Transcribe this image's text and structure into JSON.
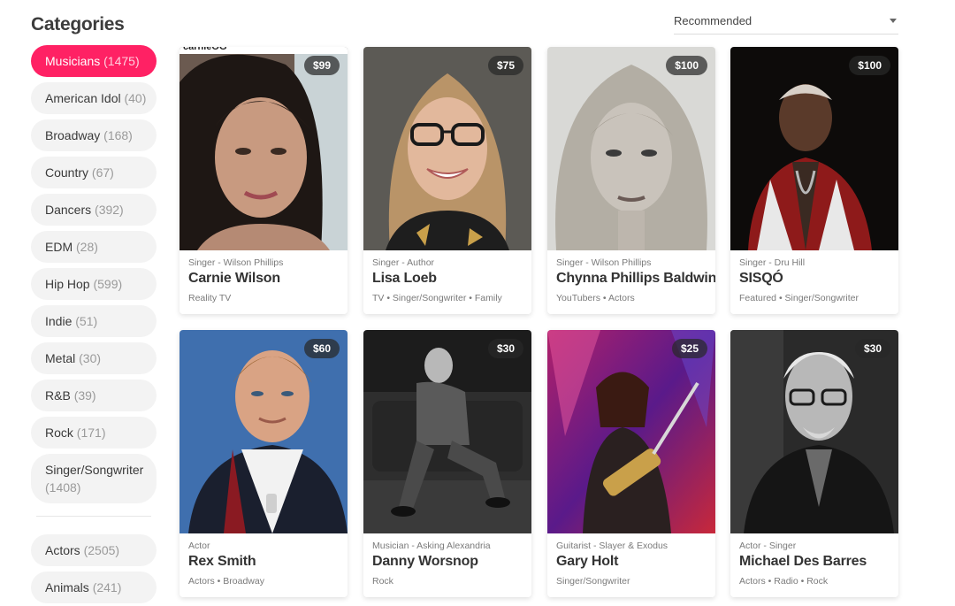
{
  "sidebar": {
    "title": "Categories",
    "categories": [
      {
        "name": "Musicians",
        "count": "(1475)"
      },
      {
        "name": "American Idol",
        "count": "(40)"
      },
      {
        "name": "Broadway",
        "count": "(168)"
      },
      {
        "name": "Country",
        "count": "(67)"
      },
      {
        "name": "Dancers",
        "count": "(392)"
      },
      {
        "name": "EDM",
        "count": "(28)"
      },
      {
        "name": "Hip Hop",
        "count": "(599)"
      },
      {
        "name": "Indie",
        "count": "(51)"
      },
      {
        "name": "Metal",
        "count": "(30)"
      },
      {
        "name": "R&B",
        "count": "(39)"
      },
      {
        "name": "Rock",
        "count": "(171)"
      },
      {
        "name": "Singer/Songwriter",
        "count": "(1408)"
      }
    ],
    "more_categories": [
      {
        "name": "Actors",
        "count": "(2505)"
      },
      {
        "name": "Animals",
        "count": "(241)"
      }
    ]
  },
  "sort": {
    "selected": "Recommended"
  },
  "colors": {
    "accent": "#ff2164"
  },
  "cards": [
    {
      "price": "$99",
      "role": "Singer - Wilson Phillips",
      "name": "Carnie Wilson",
      "tags": "Reality TV",
      "watermark": "carnieOG"
    },
    {
      "price": "$75",
      "role": "Singer - Author",
      "name": "Lisa Loeb",
      "tags": "TV • Singer/Songwriter • Family"
    },
    {
      "price": "$100",
      "role": "Singer - Wilson Phillips",
      "name": "Chynna Phillips Baldwin",
      "tags": "YouTubers • Actors"
    },
    {
      "price": "$100",
      "role": "Singer - Dru Hill",
      "name": "SISQÓ",
      "tags": "Featured • Singer/Songwriter"
    },
    {
      "price": "$60",
      "role": "Actor",
      "name": "Rex Smith",
      "tags": "Actors • Broadway"
    },
    {
      "price": "$30",
      "role": "Musician - Asking Alexandria",
      "name": "Danny Worsnop",
      "tags": "Rock"
    },
    {
      "price": "$25",
      "role": "Guitarist - Slayer & Exodus",
      "name": "Gary Holt",
      "tags": "Singer/Songwriter"
    },
    {
      "price": "$30",
      "role": "Actor - Singer",
      "name": "Michael Des Barres",
      "tags": "Actors • Radio • Rock"
    }
  ]
}
